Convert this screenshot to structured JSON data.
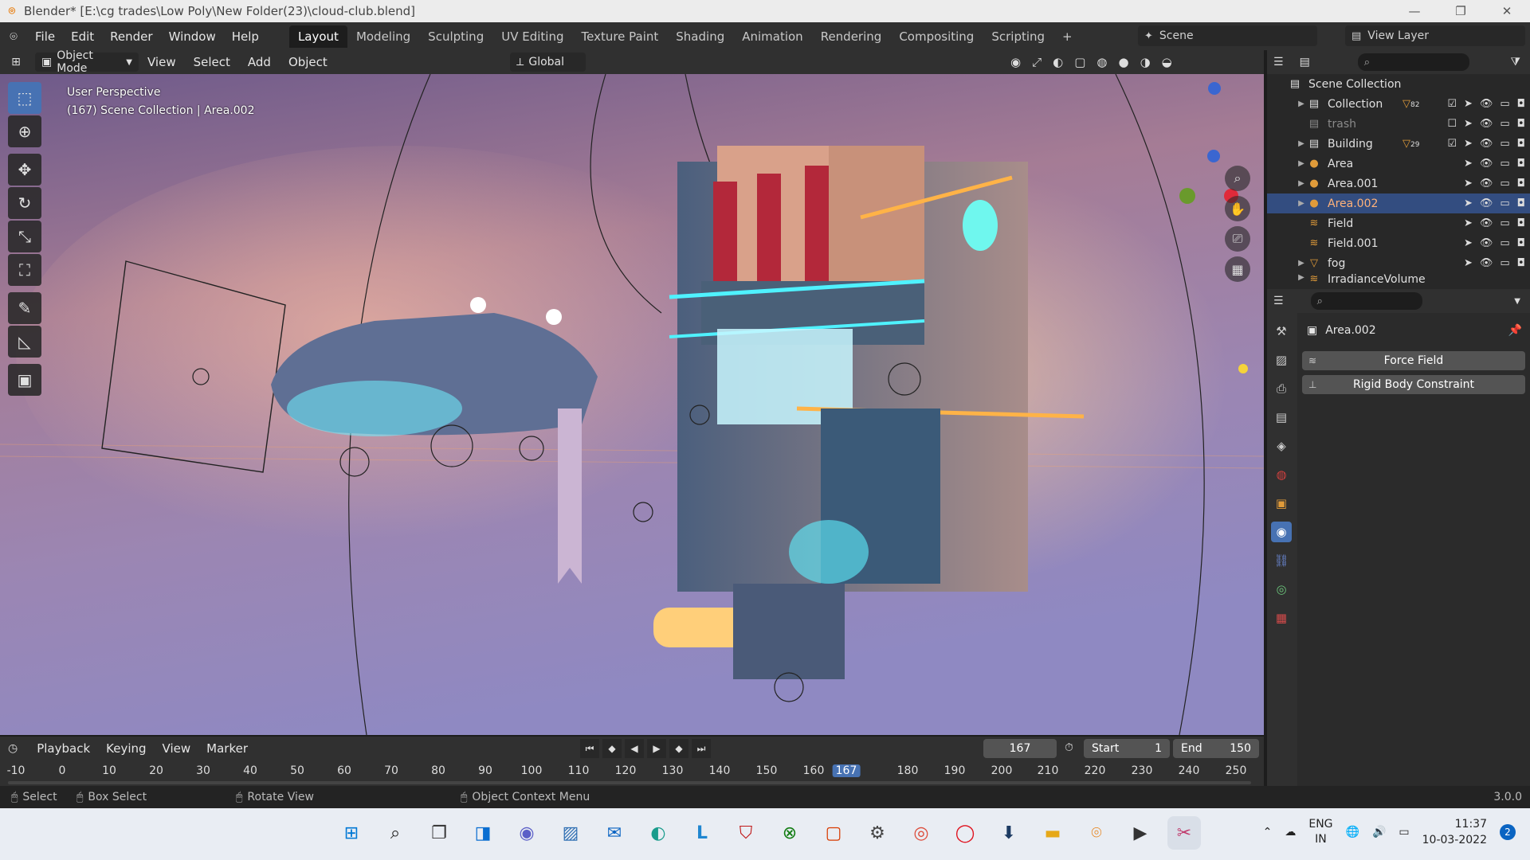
{
  "window": {
    "title": "Blender* [E:\\cg trades\\Low Poly\\New Folder(23)\\cloud-club.blend]",
    "controls": [
      "—",
      "❐",
      "✕"
    ]
  },
  "menu": [
    "File",
    "Edit",
    "Render",
    "Window",
    "Help"
  ],
  "workspaces": [
    "Layout",
    "Modeling",
    "Sculpting",
    "UV Editing",
    "Texture Paint",
    "Shading",
    "Animation",
    "Rendering",
    "Compositing",
    "Scripting",
    "+"
  ],
  "scene": "Scene",
  "view_layer": "View Layer",
  "viewport_header": {
    "mode": "Object Mode",
    "items": [
      "View",
      "Select",
      "Add",
      "Object"
    ],
    "transform": "Global"
  },
  "viewport": {
    "perspective": "User Perspective",
    "collection_info": "(167) Scene Collection | Area.002"
  },
  "outliner": {
    "root": "Scene Collection",
    "rows": [
      {
        "name": "Collection",
        "badge": "82"
      },
      {
        "name": "trash"
      },
      {
        "name": "Building",
        "badge": "29"
      },
      {
        "name": "Area"
      },
      {
        "name": "Area.001"
      },
      {
        "name": "Area.002"
      },
      {
        "name": "Field"
      },
      {
        "name": "Field.001"
      },
      {
        "name": "fog"
      },
      {
        "name": "IrradianceVolume"
      }
    ]
  },
  "properties": {
    "object_name": "Area.002",
    "buttons": [
      "Force Field",
      "Rigid Body Constraint"
    ]
  },
  "timeline": {
    "menus": [
      "Playback",
      "Keying",
      "View",
      "Marker"
    ],
    "current_frame": "167",
    "start_label": "Start",
    "start": "1",
    "end_label": "End",
    "end": "150",
    "ruler": [
      "-10",
      "0",
      "10",
      "20",
      "30",
      "40",
      "50",
      "60",
      "70",
      "80",
      "90",
      "100",
      "110",
      "120",
      "130",
      "140",
      "150",
      "160",
      "167",
      "180",
      "190",
      "200",
      "210",
      "220",
      "230",
      "240",
      "250"
    ]
  },
  "status": {
    "select": "Select",
    "box_select": "Box Select",
    "rotate": "Rotate View",
    "context": "Object Context Menu",
    "version": "3.0.0"
  },
  "taskbar": {
    "lang": "ENG",
    "region": "IN",
    "time": "11:37",
    "date": "10-03-2022",
    "notif": "2"
  },
  "colors": {
    "accent": "#4772b3",
    "selection": "#334d80",
    "orange": "#e87d0d"
  }
}
